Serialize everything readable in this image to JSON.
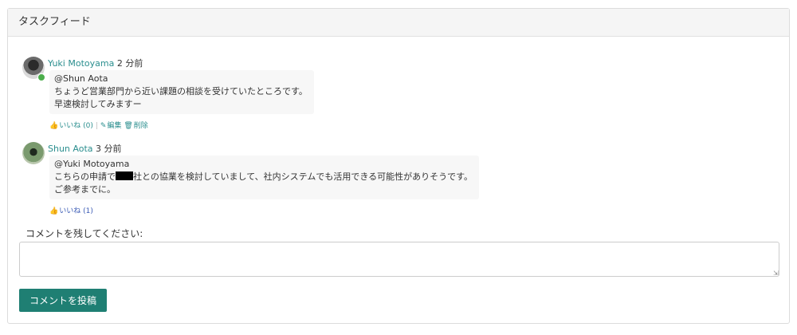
{
  "panel": {
    "title": "タスクフィード"
  },
  "comments": [
    {
      "author": "Yuki Motoyama",
      "time": "2 分前",
      "lines": [
        "@Shun Aota",
        "ちょうど営業部門から近い課題の相談を受けていたところです。",
        "早速検討してみますー"
      ],
      "actions": {
        "like": "いいね (0)",
        "edit": "編集",
        "delete": "削除"
      }
    },
    {
      "author": "Shun Aota",
      "time": "3 分前",
      "lines": [
        "@Yuki Motoyama",
        "こちらの申請で",
        "社との協業を検討していまして、社内システムでも活用できる可能性がありそうです。",
        "ご参考までに。"
      ],
      "actions": {
        "like": "いいね (1)"
      }
    }
  ],
  "form": {
    "label": "コメントを残してください:",
    "value": "",
    "submit_label": "コメントを投稿"
  },
  "colors": {
    "accent": "#1f7f73",
    "link": "#2a8e8e",
    "like_active": "#3b5bb5"
  },
  "icons": {
    "like": "thumbs-up-icon",
    "edit": "edit-icon",
    "delete": "trash-icon",
    "online": "online-status-icon"
  }
}
